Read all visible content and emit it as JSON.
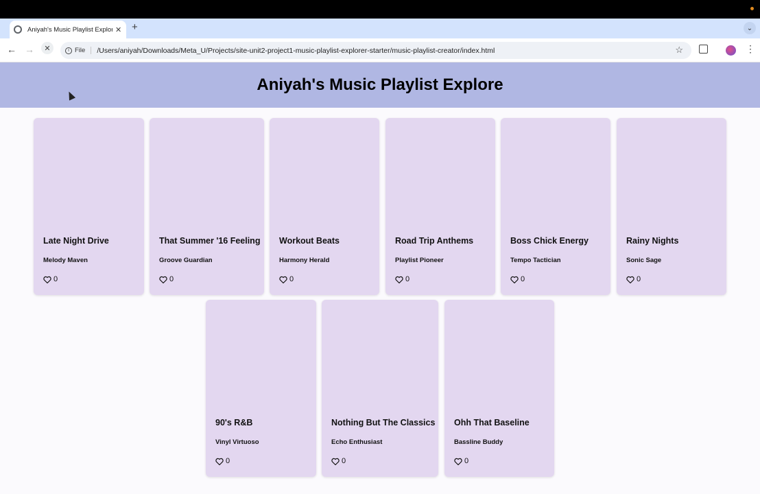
{
  "browser": {
    "tab_title": "Aniyah's Music Playlist Explorer",
    "scheme_label": "File",
    "url": "/Users/aniyah/Downloads/Meta_U/Projects/site-unit2-project1-music-playlist-explorer-starter/music-playlist-creator/index.html"
  },
  "page": {
    "title": "Aniyah's Music Playlist Explore"
  },
  "playlists": [
    {
      "name": "Late Night Drive",
      "creator": "Melody Maven",
      "likes": "0"
    },
    {
      "name": "That Summer '16 Feeling",
      "creator": "Groove Guardian",
      "likes": "0"
    },
    {
      "name": "Workout Beats",
      "creator": "Harmony Herald",
      "likes": "0"
    },
    {
      "name": "Road Trip Anthems",
      "creator": "Playlist Pioneer",
      "likes": "0"
    },
    {
      "name": "Boss Chick Energy",
      "creator": "Tempo Tactician",
      "likes": "0"
    },
    {
      "name": "Rainy Nights",
      "creator": "Sonic Sage",
      "likes": "0"
    },
    {
      "name": "90's R&B",
      "creator": "Vinyl Virtuoso",
      "likes": "0"
    },
    {
      "name": "Nothing But The Classics",
      "creator": "Echo Enthusiast",
      "likes": "0"
    },
    {
      "name": "Ohh That Baseline",
      "creator": "Bassline Buddy",
      "likes": "0"
    }
  ],
  "colors": {
    "header_bg": "#b0b7e3",
    "card_bg": "#e3d7f0",
    "page_bg": "#fbfafd"
  }
}
